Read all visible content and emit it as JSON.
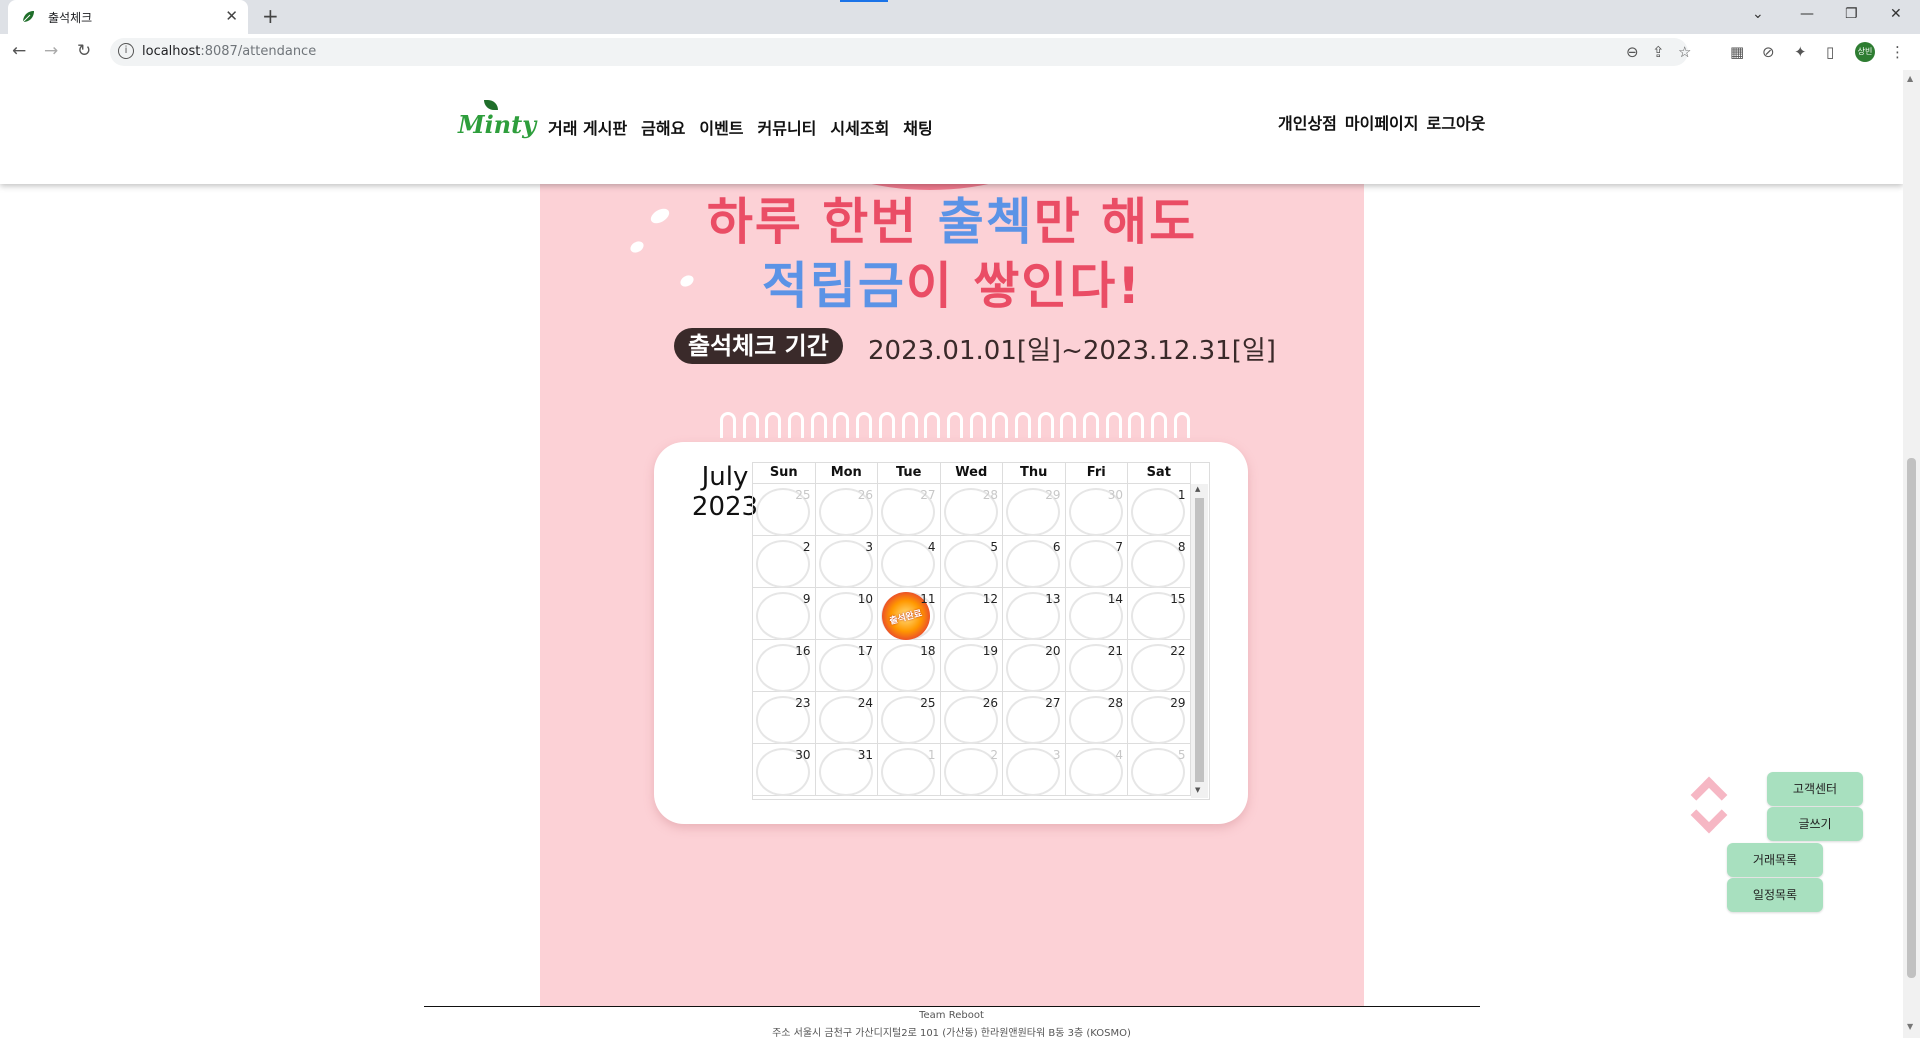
{
  "browser": {
    "tab_title": "출석체크",
    "url_host": "localhost",
    "url_rest": ":8087/attendance",
    "profile_initials": "상빈"
  },
  "header": {
    "logo": "Minty",
    "menu": [
      "거래 게시판",
      "금해요",
      "이벤트",
      "커뮤니티",
      "시세조회",
      "채팅"
    ],
    "user_menu": [
      "개인상점",
      "마이페이지",
      "로그아웃"
    ]
  },
  "banner": {
    "line1_a": "하루 한번 ",
    "line1_b": "출첵",
    "line1_c": "만 해도",
    "line2_a": "적립금",
    "line2_b": "이 쌓인다!",
    "period_label": "출석체크 기간",
    "period_dates": "2023.01.01[일]~2023.12.31[일]"
  },
  "calendar": {
    "month": "July",
    "year": "2023",
    "weekdays": [
      "Sun",
      "Mon",
      "Tue",
      "Wed",
      "Thu",
      "Fri",
      "Sat"
    ],
    "days": [
      {
        "n": "25",
        "other": true
      },
      {
        "n": "26",
        "other": true
      },
      {
        "n": "27",
        "other": true
      },
      {
        "n": "28",
        "other": true
      },
      {
        "n": "29",
        "other": true
      },
      {
        "n": "30",
        "other": true
      },
      {
        "n": "1",
        "other": false
      },
      {
        "n": "2",
        "other": false
      },
      {
        "n": "3",
        "other": false
      },
      {
        "n": "4",
        "other": false
      },
      {
        "n": "5",
        "other": false
      },
      {
        "n": "6",
        "other": false
      },
      {
        "n": "7",
        "other": false
      },
      {
        "n": "8",
        "other": false
      },
      {
        "n": "9",
        "other": false
      },
      {
        "n": "10",
        "other": false
      },
      {
        "n": "11",
        "other": false,
        "stamp": true
      },
      {
        "n": "12",
        "other": false
      },
      {
        "n": "13",
        "other": false
      },
      {
        "n": "14",
        "other": false
      },
      {
        "n": "15",
        "other": false
      },
      {
        "n": "16",
        "other": false
      },
      {
        "n": "17",
        "other": false
      },
      {
        "n": "18",
        "other": false
      },
      {
        "n": "19",
        "other": false
      },
      {
        "n": "20",
        "other": false
      },
      {
        "n": "21",
        "other": false
      },
      {
        "n": "22",
        "other": false
      },
      {
        "n": "23",
        "other": false
      },
      {
        "n": "24",
        "other": false
      },
      {
        "n": "25",
        "other": false
      },
      {
        "n": "26",
        "other": false
      },
      {
        "n": "27",
        "other": false
      },
      {
        "n": "28",
        "other": false
      },
      {
        "n": "29",
        "other": false
      },
      {
        "n": "30",
        "other": false
      },
      {
        "n": "31",
        "other": false
      },
      {
        "n": "1",
        "other": true
      },
      {
        "n": "2",
        "other": true
      },
      {
        "n": "3",
        "other": true
      },
      {
        "n": "4",
        "other": true
      },
      {
        "n": "5",
        "other": true
      }
    ],
    "stamp_label": "출석완료"
  },
  "floating": {
    "customer_center": "고객센터",
    "write": "글쓰기",
    "trade_list": "거래목록",
    "schedule_list": "일정목록"
  },
  "footer": {
    "team": "Team Reboot",
    "address": "주소 서울시 금천구 가산디지털2로 101 (가산동) 한라원앤원타워 B동 3층 (KOSMO)"
  },
  "colors": {
    "banner_bg": "#fcd1d6",
    "headline_red": "#ea4d65",
    "headline_blue": "#5b93e6",
    "button_green": "#a8e0bf"
  }
}
